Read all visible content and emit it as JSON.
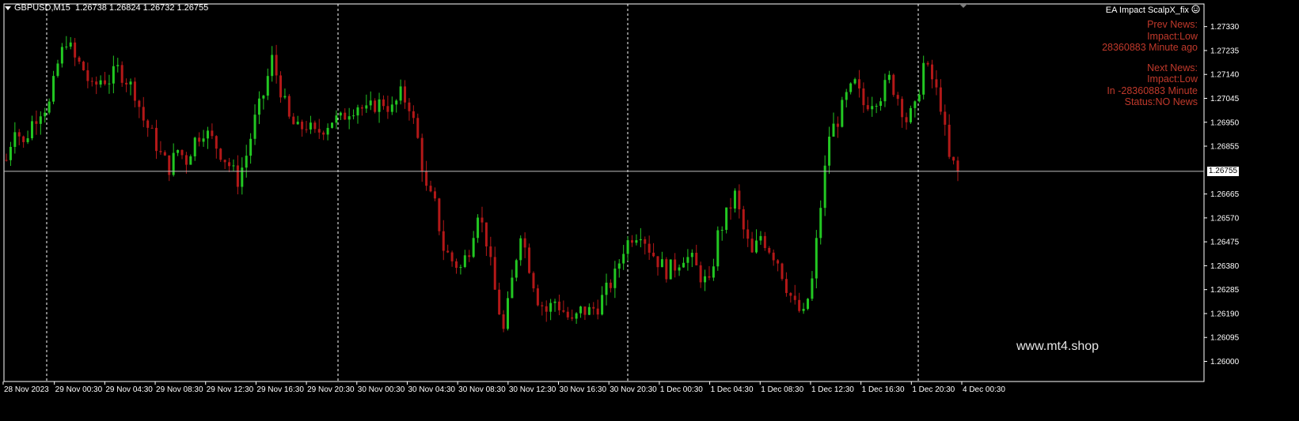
{
  "header": {
    "symbol": "GBPUSD,M15",
    "ohlc": "1.26738 1.26824 1.26732 1.26755"
  },
  "ea": {
    "name": "EA Impact ScalpX_fix",
    "smiley_icon": "smiley-icon"
  },
  "news": {
    "prev_title": "Prev News:",
    "prev_impact": "Impact:Low",
    "prev_time": "28360883 Minute ago",
    "next_title": "Next News:",
    "next_impact": "Impact:Low",
    "next_time": "In -28360883 Minute",
    "status": "Status:NO News"
  },
  "watermark": "www.mt4.shop",
  "current_price": "1.26755",
  "colors": {
    "background": "#000000",
    "bull": "#22c722",
    "bear": "#b31818",
    "grid": "#ffffff",
    "news_text": "#c0392b"
  },
  "chart_data": {
    "type": "candlestick",
    "symbol": "GBPUSD",
    "timeframe": "M15",
    "price_axis": {
      "ylim": [
        1.2592,
        1.2742
      ],
      "ticks": [
        "1.27330",
        "1.27235",
        "1.27140",
        "1.27045",
        "1.26950",
        "1.26855",
        "1.26665",
        "1.26570",
        "1.26475",
        "1.26380",
        "1.26285",
        "1.26190",
        "1.26095",
        "1.26000"
      ]
    },
    "time_axis": {
      "labels": [
        "28 Nov 2023",
        "29 Nov 00:30",
        "29 Nov 04:30",
        "29 Nov 08:30",
        "29 Nov 12:30",
        "29 Nov 16:30",
        "29 Nov 20:30",
        "30 Nov 00:30",
        "30 Nov 04:30",
        "30 Nov 08:30",
        "30 Nov 12:30",
        "30 Nov 16:30",
        "30 Nov 20:30",
        "1 Dec 00:30",
        "1 Dec 04:30",
        "1 Dec 08:30",
        "1 Dec 12:30",
        "1 Dec 16:30",
        "1 Dec 20:30",
        "4 Dec 00:30"
      ]
    },
    "current_price": 1.26755,
    "close_path": [
      [
        0,
        1.268
      ],
      [
        2,
        1.2694
      ],
      [
        4,
        1.2686
      ],
      [
        6,
        1.2695
      ],
      [
        8,
        1.27
      ],
      [
        10,
        1.2702
      ],
      [
        12,
        1.2718
      ],
      [
        14,
        1.2728
      ],
      [
        16,
        1.272
      ],
      [
        18,
        1.2716
      ],
      [
        20,
        1.2708
      ],
      [
        22,
        1.2712
      ],
      [
        24,
        1.2712
      ],
      [
        26,
        1.2716
      ],
      [
        28,
        1.2712
      ],
      [
        30,
        1.2707
      ],
      [
        32,
        1.2696
      ],
      [
        34,
        1.269
      ],
      [
        36,
        1.2682
      ],
      [
        38,
        1.2677
      ],
      [
        40,
        1.2684
      ],
      [
        42,
        1.268
      ],
      [
        44,
        1.2688
      ],
      [
        46,
        1.2692
      ],
      [
        48,
        1.2688
      ],
      [
        50,
        1.2683
      ],
      [
        52,
        1.2678
      ],
      [
        54,
        1.2672
      ],
      [
        56,
        1.2682
      ],
      [
        58,
        1.2696
      ],
      [
        60,
        1.2706
      ],
      [
        62,
        1.272
      ],
      [
        64,
        1.2708
      ],
      [
        66,
        1.2696
      ],
      [
        68,
        1.2692
      ],
      [
        70,
        1.2694
      ],
      [
        72,
        1.269
      ],
      [
        74,
        1.2693
      ],
      [
        76,
        1.2696
      ],
      [
        78,
        1.2696
      ],
      [
        80,
        1.27
      ],
      [
        82,
        1.2702
      ],
      [
        84,
        1.2699
      ],
      [
        86,
        1.2702
      ],
      [
        88,
        1.2703
      ],
      [
        90,
        1.27
      ],
      [
        92,
        1.2706
      ],
      [
        94,
        1.2702
      ],
      [
        96,
        1.2688
      ],
      [
        98,
        1.2668
      ],
      [
        100,
        1.2662
      ],
      [
        102,
        1.2645
      ],
      [
        104,
        1.264
      ],
      [
        106,
        1.2637
      ],
      [
        108,
        1.2645
      ],
      [
        110,
        1.266
      ],
      [
        112,
        1.2648
      ],
      [
        114,
        1.2628
      ],
      [
        116,
        1.2612
      ],
      [
        118,
        1.2632
      ],
      [
        120,
        1.2652
      ],
      [
        122,
        1.2638
      ],
      [
        124,
        1.2625
      ],
      [
        126,
        1.262
      ],
      [
        128,
        1.2624
      ],
      [
        130,
        1.262
      ],
      [
        132,
        1.2615
      ],
      [
        134,
        1.262
      ],
      [
        136,
        1.262
      ],
      [
        138,
        1.2622
      ],
      [
        140,
        1.2628
      ],
      [
        142,
        1.2634
      ],
      [
        144,
        1.2645
      ],
      [
        146,
        1.265
      ],
      [
        148,
        1.2652
      ],
      [
        150,
        1.2645
      ],
      [
        152,
        1.264
      ],
      [
        154,
        1.2636
      ],
      [
        156,
        1.2638
      ],
      [
        158,
        1.2642
      ],
      [
        160,
        1.264
      ],
      [
        162,
        1.2634
      ],
      [
        164,
        1.263
      ],
      [
        166,
        1.265
      ],
      [
        168,
        1.2658
      ],
      [
        170,
        1.2666
      ],
      [
        172,
        1.2652
      ],
      [
        174,
        1.2642
      ],
      [
        176,
        1.265
      ],
      [
        178,
        1.2645
      ],
      [
        180,
        1.264
      ],
      [
        182,
        1.263
      ],
      [
        184,
        1.2622
      ],
      [
        186,
        1.2618
      ],
      [
        188,
        1.2632
      ],
      [
        190,
        1.2662
      ],
      [
        192,
        1.269
      ],
      [
        194,
        1.2696
      ],
      [
        196,
        1.2705
      ],
      [
        198,
        1.271
      ],
      [
        200,
        1.2702
      ],
      [
        202,
        1.2704
      ],
      [
        204,
        1.2706
      ],
      [
        206,
        1.2712
      ],
      [
        208,
        1.2705
      ],
      [
        210,
        1.2696
      ],
      [
        212,
        1.27
      ],
      [
        214,
        1.2718
      ],
      [
        216,
        1.2712
      ],
      [
        218,
        1.2702
      ],
      [
        220,
        1.268
      ],
      [
        222,
        1.2676
      ]
    ]
  }
}
